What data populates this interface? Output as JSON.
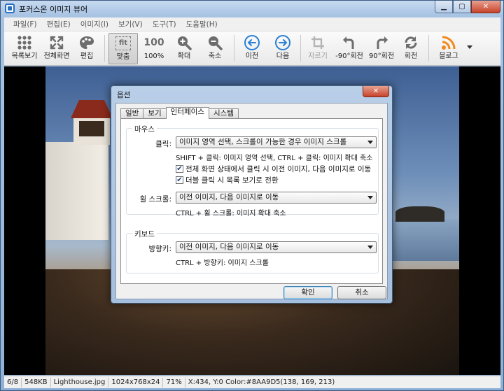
{
  "window": {
    "title": "포커스온 이미지 뷰어",
    "minimize": "▁",
    "maximize": "▢",
    "close": "✕"
  },
  "menu": [
    "파일(F)",
    "편집(E)",
    "이미지(I)",
    "보기(V)",
    "도구(T)",
    "도움말(H)"
  ],
  "toolbar": {
    "thumbs": "목록보기",
    "fullscreen": "전체화면",
    "edit": "편집",
    "fit": "맞춤",
    "fit_glyph": "fit",
    "actual": "100%",
    "actual_glyph": "100",
    "zoom_in": "확대",
    "zoom_out": "축소",
    "prev": "이전",
    "next": "다음",
    "crop": "자르기",
    "rotate_ccw": "-90°회전",
    "rotate_cw": "90°회전",
    "rotate": "회전",
    "blog": "블로그"
  },
  "status": {
    "index": "6/8",
    "size": "548KB",
    "filename": "Lighthouse.jpg",
    "dims": "1024x768x24",
    "zoom": "71%",
    "coords": "X:434, Y:0 Color:#8AA9D5(138, 169, 213)"
  },
  "dialog": {
    "title": "옵션",
    "close": "✕",
    "tabs": [
      "일반",
      "보기",
      "인터페이스",
      "시스템"
    ],
    "mouse": {
      "group": "마우스",
      "click_label": "클릭:",
      "click_value": "이미지 영역 선택, 스크롤이 가능한 경우 이미지 스크롤",
      "click_note": "SHIFT + 클릭: 이미지 영역 선택, CTRL + 클릭: 이미지 확대 축소",
      "check1": "전체 화면 상태에서 클릭 시 이전 이미지, 다음 이미지로 이동",
      "check2": "더블 클릭 시 목록 보기로 전환",
      "wheel_label": "휠 스크롤:",
      "wheel_value": "이전 이미지, 다음 이미지로 이동",
      "wheel_note": "CTRL + 휠 스크롤: 이미지 확대 축소"
    },
    "keyboard": {
      "group": "키보드",
      "arrow_label": "방향키:",
      "arrow_value": "이전 이미지, 다음 이미지로 이동",
      "arrow_note": "CTRL + 방향키: 이미지 스크롤"
    },
    "ok": "확인",
    "cancel": "취소",
    "check_glyph": "✔"
  },
  "colors": {
    "accent_blue": "#2a7fd4",
    "feed_orange": "#f08a1c"
  }
}
